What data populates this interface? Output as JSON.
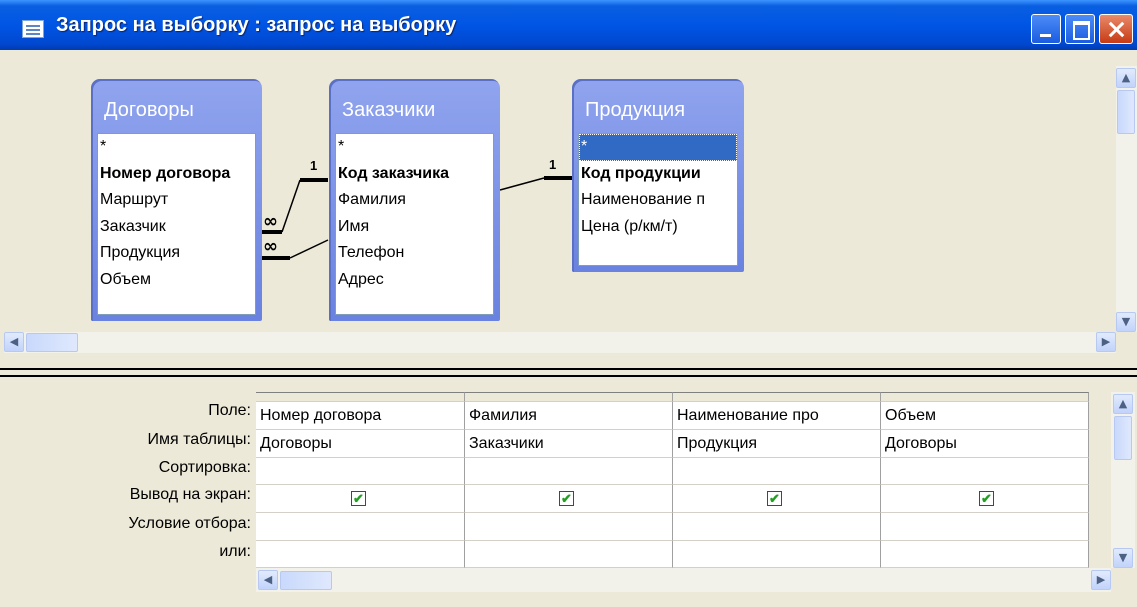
{
  "window": {
    "title": "Запрос на выборку : запрос на выборку",
    "icon": "query-icon",
    "buttons": [
      "minimize-icon",
      "maximize-icon",
      "close-icon"
    ]
  },
  "tables": [
    {
      "title": "Договоры",
      "fields": [
        "*",
        "Номер договора",
        "Маршрут",
        "Заказчик",
        "Продукция",
        "Объем"
      ],
      "key_field": "Номер договора"
    },
    {
      "title": "Заказчики",
      "fields": [
        "*",
        "Код заказчика",
        "Фамилия",
        "Имя",
        "Телефон",
        "Адрес"
      ],
      "key_field": "Код заказчика"
    },
    {
      "title": "Продукция",
      "fields": [
        "*",
        "Код продукции",
        "Наименование п",
        "Цена (р/км/т)"
      ],
      "key_field": "Код продукции",
      "selected_field": "*"
    }
  ],
  "relations": [
    {
      "one_label": "1",
      "many_label": "∞"
    },
    {
      "one_label": "1",
      "many_label": "∞"
    }
  ],
  "grid": {
    "row_labels": [
      "Поле:",
      "Имя таблицы:",
      "Сортировка:",
      "Вывод на экран:",
      "Условие отбора:",
      "или:"
    ],
    "columns": [
      {
        "field": "Номер договора",
        "table": "Договоры",
        "show": true
      },
      {
        "field": "Фамилия",
        "table": "Заказчики",
        "show": true
      },
      {
        "field": "Наименование про",
        "table": "Продукция",
        "show": true
      },
      {
        "field": "Объем",
        "table": "Договоры",
        "show": true
      }
    ]
  },
  "colors": {
    "titlebar": "#0055e5",
    "fieldlist_header": "#7b91e6",
    "selection": "#316ac5"
  }
}
